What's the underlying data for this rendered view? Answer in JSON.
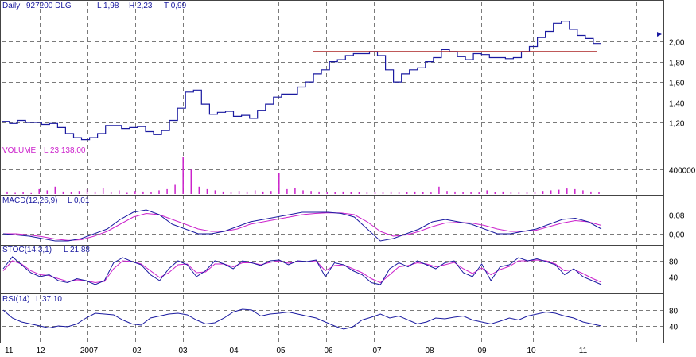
{
  "header": {
    "period": "Daily",
    "symbol": "927200 DLG",
    "low": "L 1,98",
    "high": "H 2,23",
    "turnover": "T 0,99"
  },
  "panels": {
    "volume": {
      "label": "VOLUME",
      "value": "L 23.138,00"
    },
    "macd": {
      "label": "MACD(12,26,9)",
      "value": "L 0,01"
    },
    "stoc": {
      "label": "STOC(14,3,1)",
      "value": "L 21,88"
    },
    "rsi": {
      "label": "RSI(14)",
      "value": "L 37,10"
    }
  },
  "colors": {
    "price": "#1a1aa0",
    "signal": "#cc22cc",
    "volume": "#cc22cc",
    "label": "#cc22cc",
    "resistance": "#aa2222",
    "grid": "#7a7a7a",
    "axis_text": "#000000"
  },
  "chart_data": [
    {
      "type": "line",
      "panel": "price",
      "x_ticks": [
        "11",
        "12",
        "2007",
        "02",
        "03",
        "04",
        "05",
        "06",
        "07",
        "08",
        "09",
        "10",
        "11"
      ],
      "y_ticks": [
        "1,20",
        "1,40",
        "1,60",
        "1,80",
        "2,00"
      ],
      "ylim": [
        0.98,
        2.3
      ],
      "series": [
        {
          "values": [
            1.21,
            1.19,
            1.22,
            1.2,
            1.2,
            1.18,
            1.19,
            1.15,
            1.09,
            1.05,
            1.03,
            1.05,
            1.09,
            1.17,
            1.17,
            1.14,
            1.15,
            1.16,
            1.11,
            1.08,
            1.12,
            1.22,
            1.34,
            1.5,
            1.52,
            1.38,
            1.28,
            1.3,
            1.31,
            1.26,
            1.27,
            1.24,
            1.32,
            1.38,
            1.45,
            1.48,
            1.48,
            1.55,
            1.6,
            1.68,
            1.72,
            1.8,
            1.82,
            1.86,
            1.88,
            1.88,
            1.9,
            1.86,
            1.72,
            1.6,
            1.68,
            1.72,
            1.74,
            1.8,
            1.84,
            1.92,
            1.9,
            1.85,
            1.82,
            1.88,
            1.87,
            1.84,
            1.84,
            1.83,
            1.84,
            1.9,
            1.95,
            2.04,
            2.1,
            2.18,
            2.2,
            2.12,
            2.06,
            2.03,
            1.98
          ]
        }
      ],
      "resistance_line": 1.9
    },
    {
      "type": "bar",
      "panel": "volume",
      "y_ticks": [
        "400000"
      ],
      "ylim": [
        0,
        600000
      ],
      "values": [
        40000,
        20000,
        30000,
        15000,
        80000,
        60000,
        120000,
        40000,
        30000,
        50000,
        80000,
        40000,
        100000,
        30000,
        60000,
        20000,
        50000,
        40000,
        30000,
        60000,
        80000,
        150000,
        600000,
        400000,
        120000,
        80000,
        60000,
        40000,
        30000,
        50000,
        40000,
        60000,
        40000,
        50000,
        350000,
        80000,
        100000,
        60000,
        50000,
        40000,
        30000,
        30000,
        40000,
        30000,
        35000,
        25000,
        30000,
        30000,
        40000,
        30000,
        35000,
        40000,
        30000,
        25000,
        120000,
        50000,
        40000,
        30000,
        30000,
        25000,
        60000,
        30000,
        40000,
        30000,
        25000,
        35000,
        40000,
        50000,
        60000,
        70000,
        90000,
        80000,
        60000,
        40000,
        30000
      ]
    },
    {
      "type": "line",
      "panel": "macd",
      "y_ticks": [
        "0,00",
        "0,08"
      ],
      "ylim": [
        -0.04,
        0.12
      ],
      "series": [
        {
          "values": [
            0.0,
            -0.005,
            -0.01,
            -0.02,
            -0.03,
            -0.03,
            -0.02,
            0.0,
            0.02,
            0.06,
            0.09,
            0.1,
            0.08,
            0.04,
            0.02,
            0.0,
            0.0,
            0.01,
            0.03,
            0.05,
            0.06,
            0.07,
            0.08,
            0.09,
            0.09,
            0.09,
            0.085,
            0.07,
            0.02,
            -0.03,
            -0.02,
            0.0,
            0.02,
            0.05,
            0.06,
            0.05,
            0.04,
            0.02,
            0.0,
            0.0,
            0.01,
            0.02,
            0.04,
            0.06,
            0.065,
            0.05,
            0.02
          ]
        },
        {
          "values": [
            0.0,
            0.0,
            -0.005,
            -0.012,
            -0.022,
            -0.028,
            -0.025,
            -0.01,
            0.01,
            0.04,
            0.07,
            0.085,
            0.08,
            0.06,
            0.04,
            0.02,
            0.01,
            0.01,
            0.02,
            0.04,
            0.05,
            0.06,
            0.07,
            0.08,
            0.085,
            0.088,
            0.087,
            0.08,
            0.05,
            0.01,
            -0.01,
            -0.005,
            0.01,
            0.03,
            0.045,
            0.048,
            0.045,
            0.035,
            0.02,
            0.01,
            0.01,
            0.015,
            0.03,
            0.045,
            0.055,
            0.05,
            0.035
          ]
        }
      ]
    },
    {
      "type": "line",
      "panel": "stoc",
      "y_ticks": [
        "40",
        "80"
      ],
      "ylim": [
        0,
        100
      ],
      "series": [
        {
          "values": [
            60,
            90,
            70,
            50,
            40,
            45,
            30,
            25,
            35,
            30,
            20,
            30,
            75,
            88,
            78,
            70,
            45,
            30,
            60,
            80,
            70,
            40,
            55,
            80,
            72,
            60,
            80,
            75,
            68,
            80,
            82,
            70,
            80,
            78,
            82,
            40,
            75,
            70,
            55,
            45,
            25,
            20,
            60,
            75,
            65,
            80,
            70,
            60,
            75,
            80,
            50,
            40,
            72,
            30,
            65,
            70,
            88,
            80,
            85,
            78,
            70,
            45,
            60,
            40,
            30,
            20
          ]
        },
        {
          "values": [
            55,
            80,
            72,
            55,
            45,
            43,
            35,
            28,
            32,
            30,
            25,
            28,
            60,
            80,
            78,
            72,
            55,
            38,
            50,
            70,
            72,
            50,
            52,
            72,
            72,
            65,
            75,
            75,
            70,
            76,
            80,
            74,
            78,
            78,
            80,
            55,
            68,
            70,
            60,
            50,
            35,
            25,
            45,
            65,
            68,
            75,
            72,
            65,
            70,
            76,
            60,
            48,
            62,
            45,
            58,
            66,
            80,
            80,
            82,
            80,
            72,
            55,
            58,
            48,
            36,
            26
          ]
        }
      ]
    },
    {
      "type": "line",
      "panel": "rsi",
      "y_ticks": [
        "40",
        "80"
      ],
      "ylim": [
        0,
        100
      ],
      "series": [
        {
          "values": [
            80,
            60,
            50,
            45,
            40,
            35,
            40,
            38,
            45,
            60,
            72,
            70,
            68,
            55,
            45,
            42,
            60,
            65,
            70,
            72,
            68,
            55,
            45,
            48,
            60,
            75,
            82,
            80,
            65,
            70,
            72,
            75,
            70,
            65,
            60,
            50,
            40,
            32,
            38,
            55,
            62,
            70,
            60,
            65,
            55,
            45,
            50,
            60,
            58,
            62,
            65,
            55,
            50,
            45,
            52,
            60,
            55,
            65,
            70,
            75,
            72,
            65,
            60,
            50,
            45,
            40
          ]
        }
      ]
    }
  ]
}
